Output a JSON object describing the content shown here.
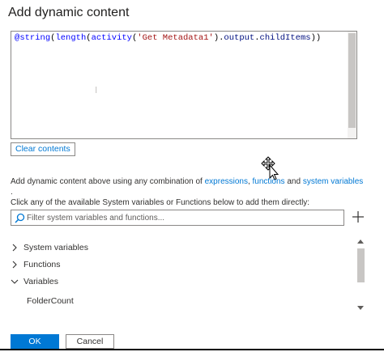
{
  "dialog": {
    "title": "Add dynamic content"
  },
  "editor": {
    "code_prefix": "@",
    "code_fn1": "string",
    "code_p1": "(",
    "code_fn2": "length",
    "code_p2": "(",
    "code_fn3": "activity",
    "code_p3": "(",
    "code_str": "'Get Metadata1'",
    "code_p4": ").",
    "code_prop1": "output",
    "code_dot": ".",
    "code_prop2": "childItems",
    "code_p5": "))"
  },
  "clear_button_label": "Clear contents",
  "help": {
    "text_before": "Add dynamic content above using any combination of ",
    "link_expressions": "expressions",
    "sep": ", ",
    "link_functions": "functions",
    "text_and": " and ",
    "link_system_variables": "system variables",
    "text_after": " .",
    "line2": "Click any of the available System variables or Functions below to add them directly:"
  },
  "search": {
    "placeholder": "Filter system variables and functions...",
    "value": ""
  },
  "tree": {
    "items": [
      {
        "label": "System variables",
        "expanded": false
      },
      {
        "label": "Functions",
        "expanded": false
      },
      {
        "label": "Variables",
        "expanded": true
      }
    ],
    "variables": [
      "FolderCount"
    ]
  },
  "footer": {
    "ok_label": "OK",
    "cancel_label": "Cancel"
  },
  "colors": {
    "accent": "#0078d4",
    "string_literal": "#a31515",
    "text": "#323130"
  }
}
